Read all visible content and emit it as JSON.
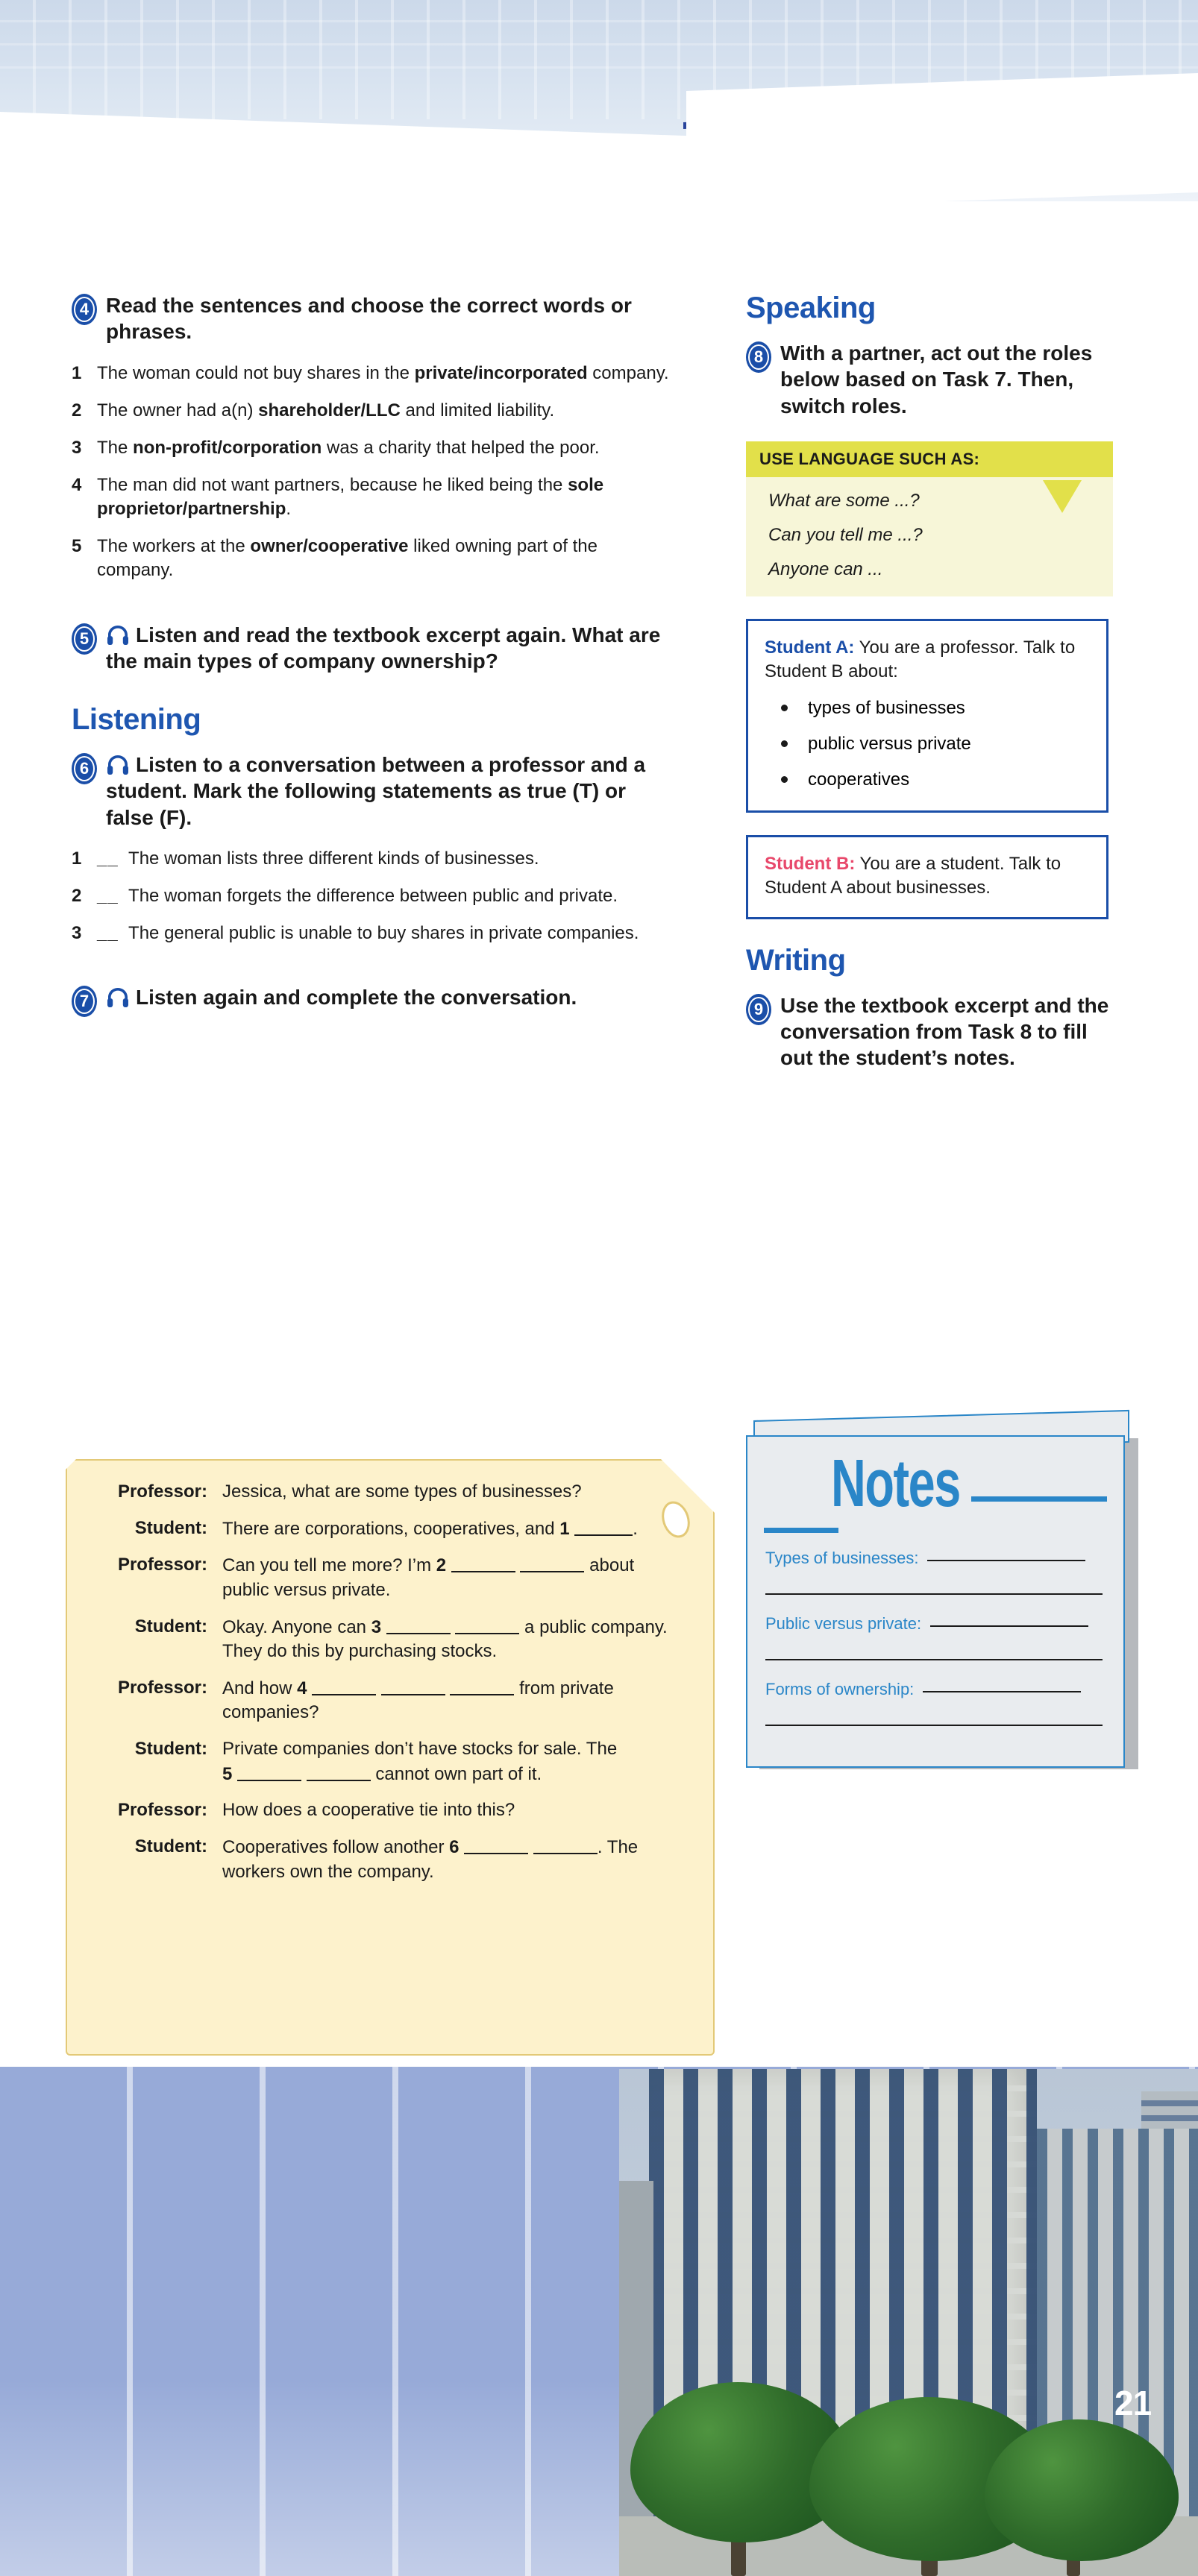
{
  "page_number": "21",
  "left_column": {
    "task4": {
      "number": "4",
      "instruction": "Read the sentences and choose the correct words or phrases.",
      "items": [
        {
          "n": "1",
          "pre": "The woman could not buy shares in the ",
          "bold": "private/incorporated",
          "post": " company."
        },
        {
          "n": "2",
          "pre": "The owner had a(n) ",
          "bold": "shareholder/LLC",
          "post": " and limited liability."
        },
        {
          "n": "3",
          "pre": "The ",
          "bold": "non-profit/corporation",
          "post": " was a charity that helped the poor."
        },
        {
          "n": "4",
          "pre": "The man did not want partners, because he liked being the ",
          "bold": "sole proprietor/partnership",
          "post": "."
        },
        {
          "n": "5",
          "pre": "The workers at the ",
          "bold": "owner/cooperative",
          "post": " liked owning part of the company."
        }
      ]
    },
    "task5": {
      "number": "5",
      "icon": "headphones-icon",
      "instruction": "Listen and read the textbook excerpt again. What are the main types of company ownership?"
    },
    "listening_heading": "Listening",
    "task6": {
      "number": "6",
      "icon": "headphones-icon",
      "instruction": "Listen to a conversation between a professor and a student. Mark the following statements as true (T) or false (F).",
      "items": [
        {
          "n": "1",
          "text": "The woman lists three different kinds of businesses."
        },
        {
          "n": "2",
          "text": "The woman forgets the difference between public and private."
        },
        {
          "n": "3",
          "text": "The general public is unable to buy shares in private companies."
        }
      ]
    },
    "task7": {
      "number": "7",
      "icon": "headphones-icon",
      "instruction": "Listen again and complete the conversation."
    }
  },
  "dialogue": {
    "lines": [
      {
        "speaker": "Professor:",
        "p1": "Jessica, what are some types of businesses?",
        "blanks": 0,
        "p2": ""
      },
      {
        "speaker": "Student:",
        "p1": "There are corporations, cooperatives, and ",
        "num": "1",
        "blanks": 1,
        "p2": "."
      },
      {
        "speaker": "Professor:",
        "p1": "Can you tell me more? I’m ",
        "num": "2",
        "blanks": 2,
        "p2": " about public versus private."
      },
      {
        "speaker": "Student:",
        "p1": "Okay. Anyone can ",
        "num": "3",
        "blanks": 2,
        "p2": " a public company. They do this by purchasing stocks."
      },
      {
        "speaker": "Professor:",
        "p1": "And how ",
        "num": "4",
        "blanks": 3,
        "p2": " from private companies?"
      },
      {
        "speaker": "Student:",
        "p1": "Private companies don’t have stocks for sale. The ",
        "num": "5",
        "blanks": 2,
        "p2": " cannot own part of it."
      },
      {
        "speaker": "Professor:",
        "p1": "How does a cooperative tie into this?",
        "blanks": 0,
        "p2": ""
      },
      {
        "speaker": "Student:",
        "p1": "Cooperatives follow another ",
        "num": "6",
        "blanks": 2,
        "p2": ". The workers own the company."
      }
    ]
  },
  "right_column": {
    "speaking_heading": "Speaking",
    "task8": {
      "number": "8",
      "instruction": "With a partner, act out the roles below based on Task 7. Then, switch roles."
    },
    "use_language": {
      "header": "USE LANGUAGE SUCH AS:",
      "phrases": [
        "What are some ...?",
        "Can you tell me ...?",
        "Anyone can ..."
      ]
    },
    "student_a": {
      "label": "Student A:",
      "text": " You are a professor. Talk to Student B about:",
      "bullets": [
        "types of businesses",
        "public versus private",
        "cooperatives"
      ]
    },
    "student_b": {
      "label": "Student B:",
      "text": " You are a student. Talk to Student A about businesses."
    },
    "writing_heading": "Writing",
    "task9": {
      "number": "9",
      "instruction": "Use the textbook excerpt and the conversation from Task 8 to fill out the student’s notes."
    },
    "notes": {
      "title": "Notes",
      "fields": [
        "Types of businesses:",
        "Public versus private:",
        "Forms of ownership:"
      ]
    }
  },
  "colors": {
    "accent_blue": "#1a4ea8",
    "heading_blue": "#1e56b0",
    "notes_blue": "#2a86c8",
    "yellow_header": "#e2e04a",
    "yellow_body": "#f7f6d8",
    "tag_cream": "#fdf2cc",
    "student_b_red": "#e8486b"
  }
}
